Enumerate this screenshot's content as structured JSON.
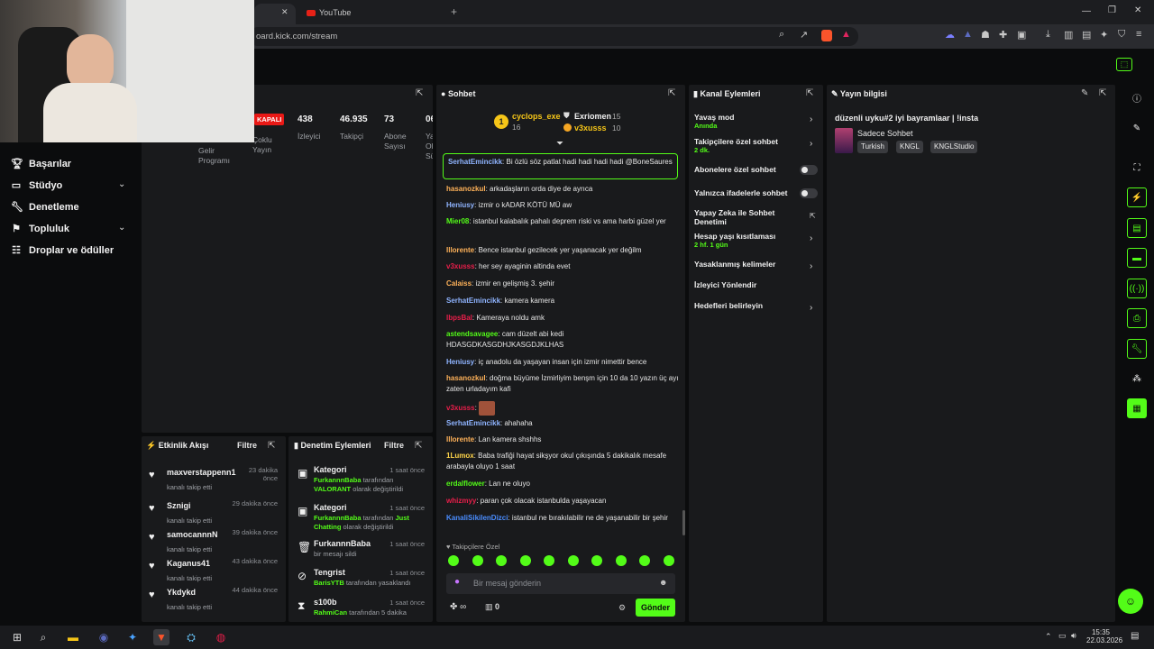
{
  "browser": {
    "tab_youtube": "YouTube",
    "tab_plus": "+",
    "url": "oard.kick.com/stream"
  },
  "sidebar": {
    "items": [
      {
        "label": "Başarılar",
        "icon": "trophy-icon"
      },
      {
        "label": "Stüdyo",
        "icon": "studio-icon"
      },
      {
        "label": "Denetleme",
        "icon": "wrench-icon"
      },
      {
        "label": "Topluluk",
        "icon": "community-icon"
      },
      {
        "label": "Droplar ve ödüller",
        "icon": "gift-icon"
      }
    ]
  },
  "stats": {
    "badge": "KAPALI",
    "gelir": "Gelir\nProgramı",
    "coklu": "Çoklu\nYayın",
    "izleyici_val": "438",
    "izleyici_lbl": "İzleyici",
    "takipci_val": "46.935",
    "takipci_lbl": "Takipçi",
    "abone_val": "73",
    "abone_lbl": "Abone\nSayısı",
    "yayin_val": "06",
    "yayin_lbl": "Yayın\nOl\nSü"
  },
  "chat": {
    "title": "Sohbet",
    "top": [
      {
        "rank": "1",
        "name": "cyclops_exe",
        "count": "16"
      },
      {
        "name": "Exriomen",
        "count": "15"
      },
      {
        "name": "v3xusss",
        "count": "10"
      }
    ],
    "pinned": {
      "name": "SerhatEmincikk",
      "text": "Bi özlü söz patlat hadi hadi hadi hadi @BoneSaures"
    },
    "messages": [
      {
        "name": "hasanozkul",
        "color": "#ffb259",
        "text": "arkadaşların orda diye de ayrıca"
      },
      {
        "name": "Heniusy",
        "color": "#8fb4ff",
        "text": "izmir o kADAR KÖTÜ MÜ aw"
      },
      {
        "name": "Mier08",
        "color": "#53fc18",
        "text": "istanbul kalabalık pahalı deprem riski vs ama harbi güzel yer"
      },
      {
        "name": "Illorente",
        "color": "#ffb259",
        "text": "Bence istanbul gezilecek yer yaşanacak yer değilm"
      },
      {
        "name": "v3xusss",
        "color": "#e91e4a",
        "text": "her sey ayaginin altinda evet"
      },
      {
        "name": "Calaiss",
        "color": "#ffb259",
        "text": "izmir en gelişmiş 3. şehir"
      },
      {
        "name": "SerhatEmincikk",
        "color": "#8fb4ff",
        "text": "kamera kamera"
      },
      {
        "name": "lbpsBal",
        "color": "#e91e4a",
        "text": "Kameraya noldu amk"
      },
      {
        "name": "astendsavagee",
        "color": "#53fc18",
        "text": "cam düzelt abi kedi HDASGDKASGDHJKASGDJKLHAS"
      },
      {
        "name": "Heniusy",
        "color": "#8fb4ff",
        "text": "iç anadolu da yaşayan insan için izmir nimettir bence"
      },
      {
        "name": "hasanozkul",
        "color": "#ffb259",
        "text": "doğma büyüme İzmirliyim benşm için 10 da 10 yazın üç ayı zaten urladayım kafi"
      },
      {
        "name": "v3xusss",
        "color": "#e91e4a",
        "text": ""
      },
      {
        "name": "SerhatEmincikk",
        "color": "#8fb4ff",
        "text": "ahahaha"
      },
      {
        "name": "Illorente",
        "color": "#ffb259",
        "text": "Lan kamera shshhs"
      },
      {
        "name": "1Lumox",
        "color": "#ffd54a",
        "text": "Baba trafiği hayat sikşyor okul çıkışında 5 dakikalık mesafe arabayla oluyo 1 saat"
      },
      {
        "name": "erdalflower",
        "color": "#53fc18",
        "text": "Lan ne oluyo"
      },
      {
        "name": "whizmyy",
        "color": "#e91e4a",
        "text": "paran çok olacak istanbulda yaşayacan"
      },
      {
        "name": "KanaliSikilenDizci",
        "color": "#4a8dff",
        "text": "istanbul ne bırakılabilir ne de yaşanabilir bir şehir"
      }
    ],
    "followers_only": "Takipçilere Özel",
    "placeholder": "Bir mesaj gönderin",
    "infinity": "∞",
    "count": "0",
    "send": "Gönder"
  },
  "activity": {
    "title": "Etkinlik Akışı",
    "filter": "Filtre",
    "items": [
      {
        "name": "maxverstappenn1",
        "sub": "kanalı takip etti",
        "time": "23 dakika\nönce"
      },
      {
        "name": "Sznigi",
        "sub": "kanalı takip etti",
        "time": "29 dakika önce"
      },
      {
        "name": "samocannnN",
        "sub": "kanalı takip etti",
        "time": "39 dakika önce"
      },
      {
        "name": "Kaganus41",
        "sub": "kanalı takip etti",
        "time": "43 dakika önce"
      },
      {
        "name": "Ykdykd",
        "sub": "kanalı takip etti",
        "time": "44 dakika önce"
      }
    ]
  },
  "moderation": {
    "title": "Denetim Eylemleri",
    "filter": "Filtre",
    "items": [
      {
        "title": "Kategori",
        "time": "1 saat önce",
        "actor": "FurkannnBaba",
        "mid": " tarafından ",
        "value": "VALORANT",
        "end": " olarak değiştirildi"
      },
      {
        "title": "Kategori",
        "time": "1 saat önce",
        "actor": "FurkannnBaba",
        "mid": " tarafından ",
        "value": "Just Chatting",
        "end": " olarak değiştirildi"
      },
      {
        "title": "FurkannnBaba",
        "time": "1 saat önce",
        "actor": "",
        "mid": "bir mesajı sildi",
        "value": "",
        "end": ""
      },
      {
        "title": "Tengrist",
        "time": "1 saat önce",
        "actor": "BarisYTB",
        "mid": " tarafından yasaklandı",
        "value": "",
        "end": ""
      },
      {
        "title": "s100b",
        "time": "1 saat önce",
        "actor": "RahmiCan",
        "mid": " tarafından 5 dakika",
        "value": "",
        "end": ""
      }
    ]
  },
  "channel_actions": {
    "title": "Kanal Eylemleri",
    "items": [
      {
        "label": "Yavaş mod",
        "sub": "Anında"
      },
      {
        "label": "Takipçilere özel sohbet",
        "sub": "2 dk."
      },
      {
        "label": "Abonelere özel sohbet",
        "sub": ""
      },
      {
        "label": "Yalnızca ifadelerle sohbet",
        "sub": ""
      },
      {
        "label": "Yapay Zeka ile Sohbet Denetimi",
        "sub": ""
      },
      {
        "label": "Hesap yaşı kısıtlaması",
        "sub": "2 hf. 1 gün"
      },
      {
        "label": "Yasaklanmış kelimeler",
        "sub": ""
      },
      {
        "label": "İzleyici Yönlendir",
        "sub": ""
      },
      {
        "label": "Hedefleri belirleyin",
        "sub": ""
      }
    ]
  },
  "stream_info": {
    "title": "Yayın bilgisi",
    "stream_title": "düzenli uyku#2 iyi bayramlaar | !insta",
    "category": "Sadece Sohbet",
    "tags": [
      "Turkish",
      "KNGL",
      "KNGLStudio"
    ]
  },
  "taskbar": {
    "time": "15:35",
    "date": "22.03.2026"
  }
}
